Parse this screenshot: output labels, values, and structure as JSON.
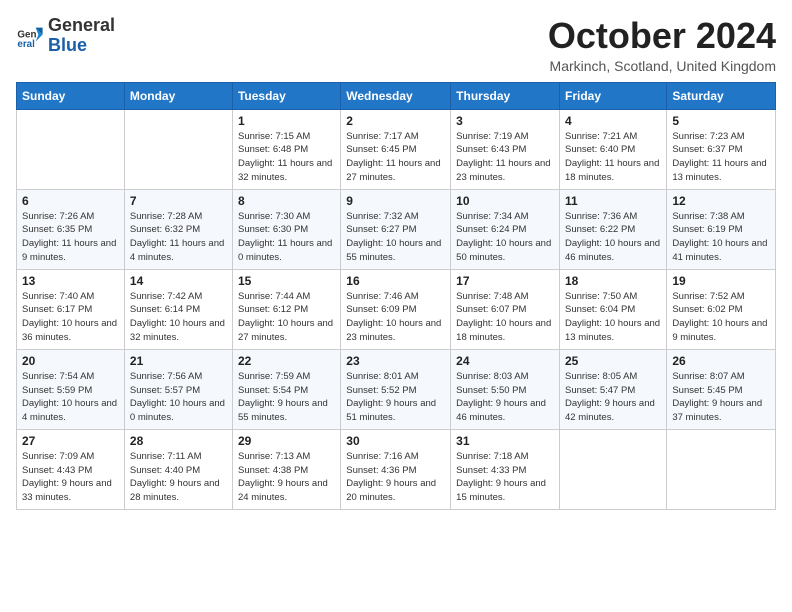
{
  "header": {
    "logo_general": "General",
    "logo_blue": "Blue",
    "month_title": "October 2024",
    "location": "Markinch, Scotland, United Kingdom"
  },
  "columns": [
    "Sunday",
    "Monday",
    "Tuesday",
    "Wednesday",
    "Thursday",
    "Friday",
    "Saturday"
  ],
  "weeks": [
    [
      {
        "day": "",
        "sunrise": "",
        "sunset": "",
        "daylight": ""
      },
      {
        "day": "",
        "sunrise": "",
        "sunset": "",
        "daylight": ""
      },
      {
        "day": "1",
        "sunrise": "Sunrise: 7:15 AM",
        "sunset": "Sunset: 6:48 PM",
        "daylight": "Daylight: 11 hours and 32 minutes."
      },
      {
        "day": "2",
        "sunrise": "Sunrise: 7:17 AM",
        "sunset": "Sunset: 6:45 PM",
        "daylight": "Daylight: 11 hours and 27 minutes."
      },
      {
        "day": "3",
        "sunrise": "Sunrise: 7:19 AM",
        "sunset": "Sunset: 6:43 PM",
        "daylight": "Daylight: 11 hours and 23 minutes."
      },
      {
        "day": "4",
        "sunrise": "Sunrise: 7:21 AM",
        "sunset": "Sunset: 6:40 PM",
        "daylight": "Daylight: 11 hours and 18 minutes."
      },
      {
        "day": "5",
        "sunrise": "Sunrise: 7:23 AM",
        "sunset": "Sunset: 6:37 PM",
        "daylight": "Daylight: 11 hours and 13 minutes."
      }
    ],
    [
      {
        "day": "6",
        "sunrise": "Sunrise: 7:26 AM",
        "sunset": "Sunset: 6:35 PM",
        "daylight": "Daylight: 11 hours and 9 minutes."
      },
      {
        "day": "7",
        "sunrise": "Sunrise: 7:28 AM",
        "sunset": "Sunset: 6:32 PM",
        "daylight": "Daylight: 11 hours and 4 minutes."
      },
      {
        "day": "8",
        "sunrise": "Sunrise: 7:30 AM",
        "sunset": "Sunset: 6:30 PM",
        "daylight": "Daylight: 11 hours and 0 minutes."
      },
      {
        "day": "9",
        "sunrise": "Sunrise: 7:32 AM",
        "sunset": "Sunset: 6:27 PM",
        "daylight": "Daylight: 10 hours and 55 minutes."
      },
      {
        "day": "10",
        "sunrise": "Sunrise: 7:34 AM",
        "sunset": "Sunset: 6:24 PM",
        "daylight": "Daylight: 10 hours and 50 minutes."
      },
      {
        "day": "11",
        "sunrise": "Sunrise: 7:36 AM",
        "sunset": "Sunset: 6:22 PM",
        "daylight": "Daylight: 10 hours and 46 minutes."
      },
      {
        "day": "12",
        "sunrise": "Sunrise: 7:38 AM",
        "sunset": "Sunset: 6:19 PM",
        "daylight": "Daylight: 10 hours and 41 minutes."
      }
    ],
    [
      {
        "day": "13",
        "sunrise": "Sunrise: 7:40 AM",
        "sunset": "Sunset: 6:17 PM",
        "daylight": "Daylight: 10 hours and 36 minutes."
      },
      {
        "day": "14",
        "sunrise": "Sunrise: 7:42 AM",
        "sunset": "Sunset: 6:14 PM",
        "daylight": "Daylight: 10 hours and 32 minutes."
      },
      {
        "day": "15",
        "sunrise": "Sunrise: 7:44 AM",
        "sunset": "Sunset: 6:12 PM",
        "daylight": "Daylight: 10 hours and 27 minutes."
      },
      {
        "day": "16",
        "sunrise": "Sunrise: 7:46 AM",
        "sunset": "Sunset: 6:09 PM",
        "daylight": "Daylight: 10 hours and 23 minutes."
      },
      {
        "day": "17",
        "sunrise": "Sunrise: 7:48 AM",
        "sunset": "Sunset: 6:07 PM",
        "daylight": "Daylight: 10 hours and 18 minutes."
      },
      {
        "day": "18",
        "sunrise": "Sunrise: 7:50 AM",
        "sunset": "Sunset: 6:04 PM",
        "daylight": "Daylight: 10 hours and 13 minutes."
      },
      {
        "day": "19",
        "sunrise": "Sunrise: 7:52 AM",
        "sunset": "Sunset: 6:02 PM",
        "daylight": "Daylight: 10 hours and 9 minutes."
      }
    ],
    [
      {
        "day": "20",
        "sunrise": "Sunrise: 7:54 AM",
        "sunset": "Sunset: 5:59 PM",
        "daylight": "Daylight: 10 hours and 4 minutes."
      },
      {
        "day": "21",
        "sunrise": "Sunrise: 7:56 AM",
        "sunset": "Sunset: 5:57 PM",
        "daylight": "Daylight: 10 hours and 0 minutes."
      },
      {
        "day": "22",
        "sunrise": "Sunrise: 7:59 AM",
        "sunset": "Sunset: 5:54 PM",
        "daylight": "Daylight: 9 hours and 55 minutes."
      },
      {
        "day": "23",
        "sunrise": "Sunrise: 8:01 AM",
        "sunset": "Sunset: 5:52 PM",
        "daylight": "Daylight: 9 hours and 51 minutes."
      },
      {
        "day": "24",
        "sunrise": "Sunrise: 8:03 AM",
        "sunset": "Sunset: 5:50 PM",
        "daylight": "Daylight: 9 hours and 46 minutes."
      },
      {
        "day": "25",
        "sunrise": "Sunrise: 8:05 AM",
        "sunset": "Sunset: 5:47 PM",
        "daylight": "Daylight: 9 hours and 42 minutes."
      },
      {
        "day": "26",
        "sunrise": "Sunrise: 8:07 AM",
        "sunset": "Sunset: 5:45 PM",
        "daylight": "Daylight: 9 hours and 37 minutes."
      }
    ],
    [
      {
        "day": "27",
        "sunrise": "Sunrise: 7:09 AM",
        "sunset": "Sunset: 4:43 PM",
        "daylight": "Daylight: 9 hours and 33 minutes."
      },
      {
        "day": "28",
        "sunrise": "Sunrise: 7:11 AM",
        "sunset": "Sunset: 4:40 PM",
        "daylight": "Daylight: 9 hours and 28 minutes."
      },
      {
        "day": "29",
        "sunrise": "Sunrise: 7:13 AM",
        "sunset": "Sunset: 4:38 PM",
        "daylight": "Daylight: 9 hours and 24 minutes."
      },
      {
        "day": "30",
        "sunrise": "Sunrise: 7:16 AM",
        "sunset": "Sunset: 4:36 PM",
        "daylight": "Daylight: 9 hours and 20 minutes."
      },
      {
        "day": "31",
        "sunrise": "Sunrise: 7:18 AM",
        "sunset": "Sunset: 4:33 PM",
        "daylight": "Daylight: 9 hours and 15 minutes."
      },
      {
        "day": "",
        "sunrise": "",
        "sunset": "",
        "daylight": ""
      },
      {
        "day": "",
        "sunrise": "",
        "sunset": "",
        "daylight": ""
      }
    ]
  ]
}
